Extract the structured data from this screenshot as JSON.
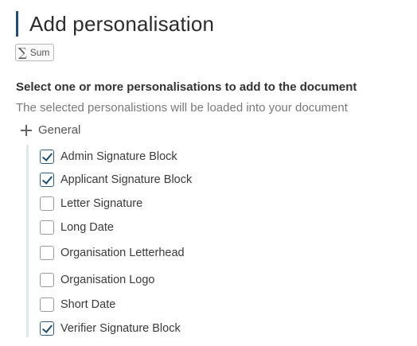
{
  "header": {
    "title": "Add personalisation"
  },
  "badge": {
    "symbol": "∑",
    "label": "Sum"
  },
  "instruction": "Select one or more personalisations to add to the document",
  "hint": "The selected personalistions will be loaded into your document",
  "group": {
    "label": "General",
    "toggle_icon": "plus-icon",
    "accent_color": "#1f4e79",
    "options": [
      {
        "label": "Admin Signature Block",
        "checked": true
      },
      {
        "label": "Applicant Signature Block",
        "checked": true
      },
      {
        "label": "Letter Signature",
        "checked": false
      },
      {
        "label": "Long Date",
        "checked": false
      },
      {
        "label": "Organisation Letterhead",
        "checked": false
      },
      {
        "label": "Organisation Logo",
        "checked": false
      },
      {
        "label": "Short Date",
        "checked": false
      },
      {
        "label": "Verifier Signature Block",
        "checked": true
      }
    ]
  }
}
